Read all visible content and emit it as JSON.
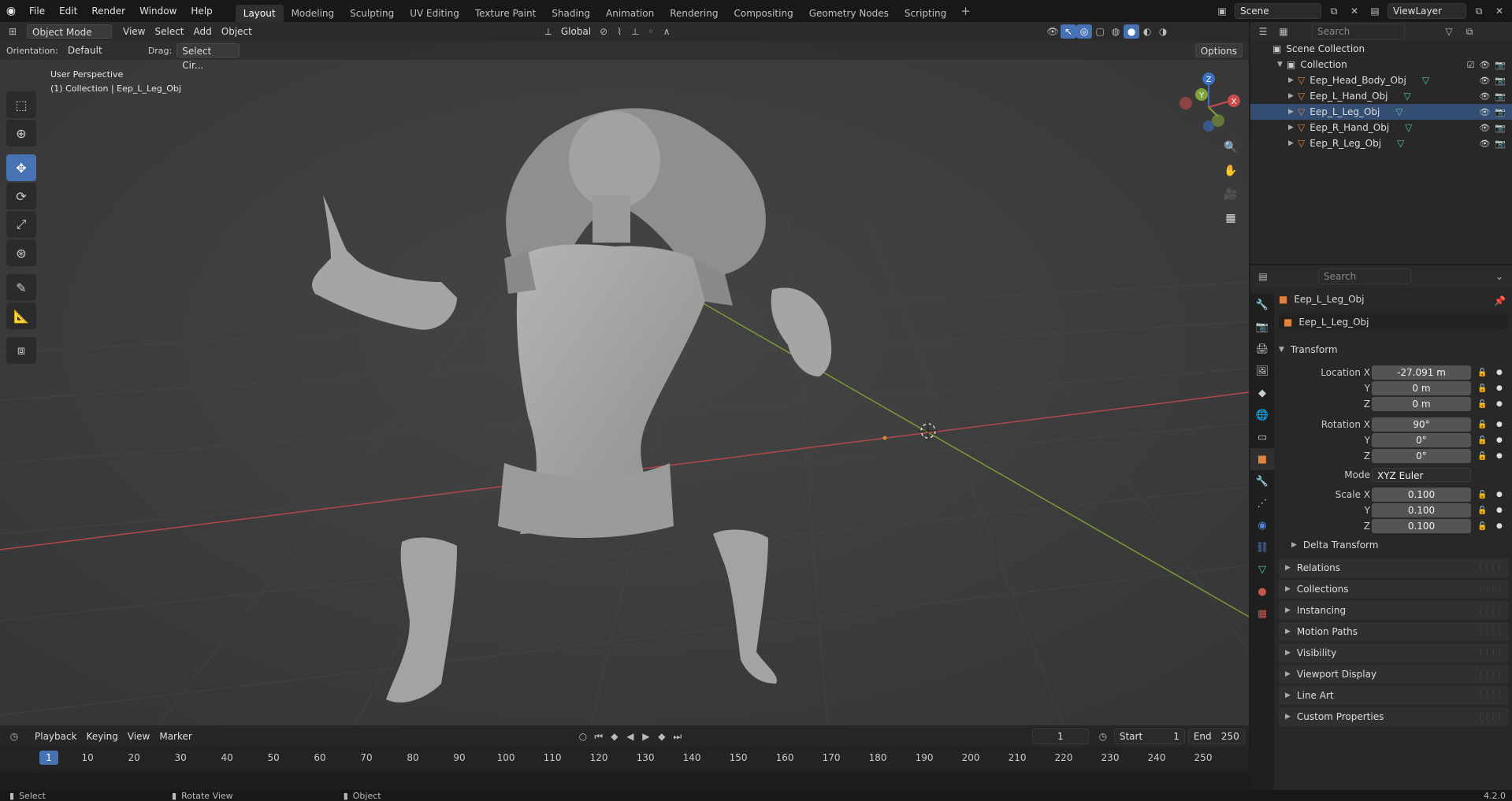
{
  "menu": {
    "items": [
      "File",
      "Edit",
      "Render",
      "Window",
      "Help"
    ]
  },
  "workspaces": {
    "tabs": [
      "Layout",
      "Modeling",
      "Sculpting",
      "UV Editing",
      "Texture Paint",
      "Shading",
      "Animation",
      "Rendering",
      "Compositing",
      "Geometry Nodes",
      "Scripting"
    ],
    "active": "Layout",
    "add_label": "+"
  },
  "top_right": {
    "scene": "Scene",
    "view_layer": "ViewLayer"
  },
  "viewport": {
    "mode": "Object Mode",
    "menus": [
      "View",
      "Select",
      "Add",
      "Object"
    ],
    "transform_orientation": "Global",
    "orientation_label": "Orientation:",
    "orientation_value": "Default",
    "drag_label": "Drag:",
    "drag_value": "Select Cir...",
    "options_label": "Options",
    "perspective_text": "User Perspective",
    "collection_text": "(1) Collection | Eep_L_Leg_Obj",
    "gizmo": {
      "x": "X",
      "y": "Y",
      "z": "Z"
    }
  },
  "toolbar": {
    "tools": [
      "select-box",
      "cursor",
      "move",
      "rotate",
      "scale",
      "transform",
      "annotate",
      "measure",
      "add-cube"
    ],
    "active": "move"
  },
  "timeline": {
    "menus": [
      "Playback",
      "Keying",
      "View",
      "Marker"
    ],
    "current_frame": "1",
    "start_label": "Start",
    "start_value": "1",
    "end_label": "End",
    "end_value": "250",
    "ticks": [
      "1",
      "10",
      "20",
      "30",
      "40",
      "50",
      "60",
      "70",
      "80",
      "90",
      "100",
      "110",
      "120",
      "130",
      "140",
      "150",
      "160",
      "170",
      "180",
      "190",
      "200",
      "210",
      "220",
      "230",
      "240",
      "250"
    ]
  },
  "statusbar": {
    "select": "Select",
    "rotate": "Rotate View",
    "object": "Object",
    "version": "4.2.0"
  },
  "outliner": {
    "search_placeholder": "Search",
    "scene_collection": "Scene Collection",
    "collection": "Collection",
    "objects": [
      "Eep_Head_Body_Obj",
      "Eep_L_Hand_Obj",
      "Eep_L_Leg_Obj",
      "Eep_R_Hand_Obj",
      "Eep_R_Leg_Obj"
    ],
    "selected": "Eep_L_Leg_Obj"
  },
  "properties": {
    "search_placeholder": "Search",
    "object_name": "Eep_L_Leg_Obj",
    "datablock_name": "Eep_L_Leg_Obj",
    "transform_label": "Transform",
    "location_label": "Location X",
    "location": {
      "x": "-27.091 m",
      "y": "0 m",
      "z": "0 m"
    },
    "rotation_label": "Rotation X",
    "rotation": {
      "x": "90°",
      "y": "0°",
      "z": "0°"
    },
    "mode_label": "Mode",
    "mode_value": "XYZ Euler",
    "scale_label": "Scale X",
    "scale": {
      "x": "0.100",
      "y": "0.100",
      "z": "0.100"
    },
    "y_label": "Y",
    "z_label": "Z",
    "delta_transform": "Delta Transform",
    "panels": [
      "Relations",
      "Collections",
      "Instancing",
      "Motion Paths",
      "Visibility",
      "Viewport Display",
      "Line Art",
      "Custom Properties"
    ]
  },
  "colors": {
    "accent": "#4772b3",
    "x_axis": "#c84b4b",
    "y_axis": "#7fa23a",
    "object_orange": "#e0823d",
    "mesh_green": "#59c2a8"
  }
}
